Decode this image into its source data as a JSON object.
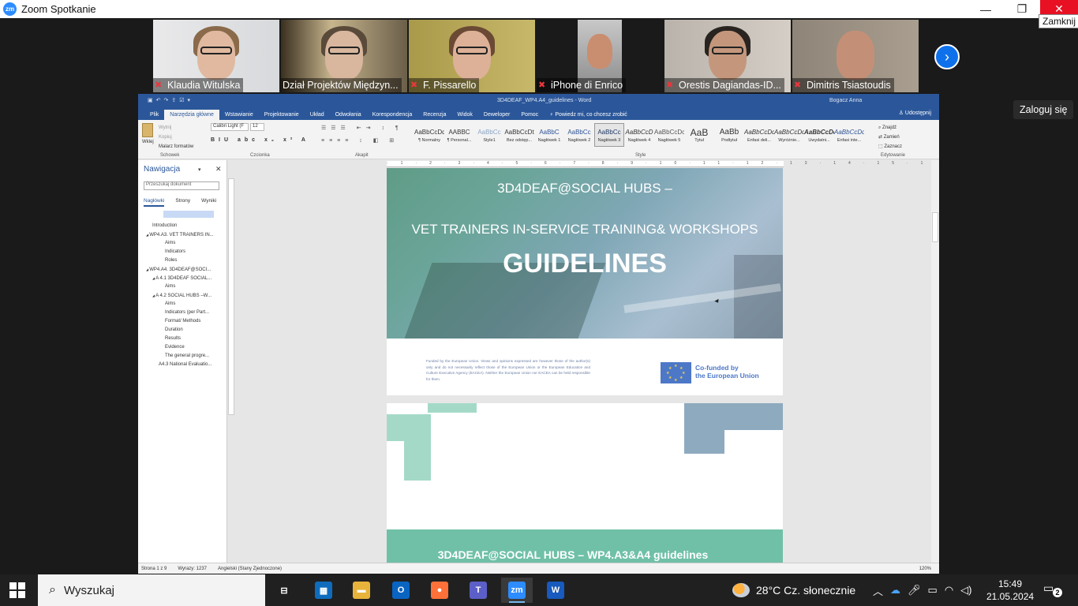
{
  "window": {
    "title": "Zoom Spotkanie",
    "close_tooltip": "Zamknij",
    "minimize_glyph": "—",
    "maximize_glyph": "❐",
    "close_glyph": "✕"
  },
  "participants": [
    {
      "name": "Klaudia Witulska",
      "muted": true
    },
    {
      "name": "Dział Projektów Międzyn...",
      "muted": false
    },
    {
      "name": "F. Pissarello",
      "muted": true
    },
    {
      "name": "iPhone di Enrico",
      "muted": true
    },
    {
      "name": "Orestis Dagiandas-ID...",
      "muted": true
    },
    {
      "name": "Dimitris Tsiastoudis",
      "muted": true
    }
  ],
  "zoom": {
    "login_label": "Zaloguj się",
    "next_icon": "chevron-right-icon"
  },
  "word": {
    "doc_title": "3D4DEAF_WP4.A4_guidelines  -  Word",
    "user": "Bogacz Anna",
    "tabs": [
      "Plik",
      "Narzędzia główne",
      "Wstawianie",
      "Projektowanie",
      "Układ",
      "Odwołania",
      "Korespondencja",
      "Recenzja",
      "Widok",
      "Deweloper",
      "Pomoc",
      "Powiedz mi, co chcesz zrobić"
    ],
    "share_label": "Udostępnij",
    "clipboard": {
      "paste_label": "Wklej",
      "items": [
        "Wytnij",
        "Kopiuj",
        "Malarz formatów"
      ],
      "group_label": "Schowek"
    },
    "font": {
      "name": "Calibri Light (F",
      "size": "12",
      "group_label": "Czcionka"
    },
    "paragraph_group_label": "Akapit",
    "styles_group_label": "Style",
    "styles": [
      {
        "sample": "AaBbCcDd",
        "name": "¶ Normalny"
      },
      {
        "sample": "AABBC",
        "name": "¶ Personal..."
      },
      {
        "sample": "AaBbCc",
        "name": "Style1"
      },
      {
        "sample": "AaBbCcDt",
        "name": "Bez odstęp..."
      },
      {
        "sample": "AaBbC",
        "name": "Nagłówek 1"
      },
      {
        "sample": "AaBbCc",
        "name": "Nagłówek 2"
      },
      {
        "sample": "AaBbCc",
        "name": "Nagłówek 3"
      },
      {
        "sample": "AaBbCcD",
        "name": "Nagłówek 4"
      },
      {
        "sample": "AaBbCcDc",
        "name": "Nagłówek 5"
      },
      {
        "sample": "AaB",
        "name": "Tytuł"
      },
      {
        "sample": "AaBb",
        "name": "Podtytuł"
      },
      {
        "sample": "AaBbCcDd",
        "name": "Enfasi deli..."
      },
      {
        "sample": "AaBbCcDd",
        "name": "Wyróżnie..."
      },
      {
        "sample": "AaBbCcDd",
        "name": "Uwydatni..."
      },
      {
        "sample": "AaBbCcDd",
        "name": "Enfasi inte..."
      }
    ],
    "editing": {
      "items": [
        "Znajdź",
        "Zamień",
        "Zaznacz"
      ],
      "group_label": "Edytowanie"
    },
    "navigation": {
      "title": "Nawigacja",
      "search_placeholder": "Przeszukaj dokument",
      "tabs": [
        "Nagłówki",
        "Strony",
        "Wyniki"
      ],
      "tree": [
        {
          "label": "Introduction",
          "level": 0
        },
        {
          "label": "WP4.A3. VET TRAINERS IN...",
          "level": 0,
          "expander": "◢"
        },
        {
          "label": "Aims",
          "level": 2
        },
        {
          "label": "Indicators",
          "level": 2
        },
        {
          "label": "Roles",
          "level": 2
        },
        {
          "label": "WP4.A4. 3D4DEAF@SOCI...",
          "level": 0,
          "expander": "◢"
        },
        {
          "label": "A 4.1 3D4DEAF SOCIAL...",
          "level": 1,
          "expander": "◢"
        },
        {
          "label": "Aims",
          "level": 2
        },
        {
          "label": "A 4.2 SOCIAL HUBS –W...",
          "level": 1,
          "expander": "◢"
        },
        {
          "label": "Aims",
          "level": 2
        },
        {
          "label": "Indicators (per Part...",
          "level": 2
        },
        {
          "label": "Format/ Methods",
          "level": 2
        },
        {
          "label": "Duration",
          "level": 2
        },
        {
          "label": "Results",
          "level": 2
        },
        {
          "label": "Evidence",
          "level": 2
        },
        {
          "label": "The general progre...",
          "level": 2
        },
        {
          "label": "A4.3 National Evaluatio...",
          "level": 1
        }
      ]
    },
    "document": {
      "cover_line1": "3D4DEAF@SOCIAL HUBS –",
      "cover_line2": "VET TRAINERS IN-SERVICE TRAINING& WORKSHOPS",
      "cover_line3": "GUIDELINES",
      "disclaimer": "Funded by the European Union. Views and opinions expressed are however those of the author(s) only and do not necessarily reflect those of the European Union or the European Education and Culture Executive Agency (EACEA). Neither the European Union nor EACEA can be held responsible for them.",
      "eu_line1": "Co-funded by",
      "eu_line2": "the European Union",
      "page2_header": "3D4DEAF@SOCIAL HUBS – WP4.A3&A4 guidelines"
    },
    "status": {
      "page": "Strona 1 z 9",
      "words": "Wyrazy: 1237",
      "language": "Angielski (Stany Zjednoczone)",
      "zoom": "120%"
    }
  },
  "taskbar": {
    "search_label": "Wyszukaj",
    "weather": "28°C  Cz. słonecznie",
    "time": "15:49",
    "date": "21.05.2024",
    "notifications": "2",
    "apps": [
      {
        "name": "task-view",
        "label": "⊟",
        "color": "#202020"
      },
      {
        "name": "microsoft-store",
        "label": "▦",
        "color": "#0f6cbd"
      },
      {
        "name": "file-explorer",
        "label": "▬",
        "color": "#e8b33a"
      },
      {
        "name": "outlook",
        "label": "O",
        "color": "#0a64c2"
      },
      {
        "name": "firefox",
        "label": "●",
        "color": "#ff7139"
      },
      {
        "name": "teams",
        "label": "T",
        "color": "#5b5fc7"
      },
      {
        "name": "zoom",
        "label": "zm",
        "color": "#2d8cff"
      },
      {
        "name": "word",
        "label": "W",
        "color": "#185abd"
      }
    ]
  }
}
